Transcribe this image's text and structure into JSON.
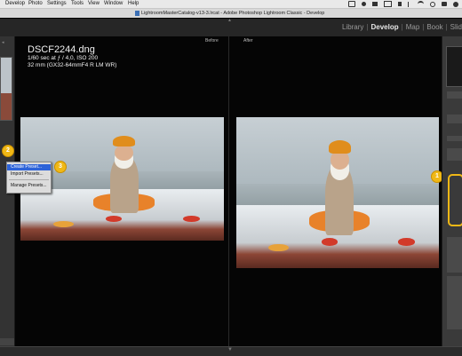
{
  "menubar": {
    "items": [
      "Develop",
      "Photo",
      "Settings",
      "Tools",
      "View",
      "Window",
      "Help"
    ]
  },
  "titlebar": {
    "title": "LightroomMasterCatalog-v13-3.lrcat - Adobe Photoshop Lightroom Classic - Develop"
  },
  "modules": {
    "items": [
      "Library",
      "Develop",
      "Map",
      "Book",
      "Slid"
    ],
    "active": "Develop"
  },
  "compare": {
    "before_label": "Before",
    "after_label": "After"
  },
  "fileinfo": {
    "filename": "DSCF2244.dng",
    "exposure": "1/60 sec at ƒ / 4,0, ISO 200",
    "lens": "32 mm (GX32-64mmF4 R LM WR)"
  },
  "context_menu": {
    "items": [
      "Create Preset...",
      "Import Presets...",
      "Manage Presets..."
    ],
    "highlighted": "Create Preset..."
  },
  "badges": [
    "1",
    "2",
    "3"
  ],
  "colors": {
    "highlight": "#f0b816",
    "menu_selection": "#2d63d8",
    "background": "#050505"
  }
}
